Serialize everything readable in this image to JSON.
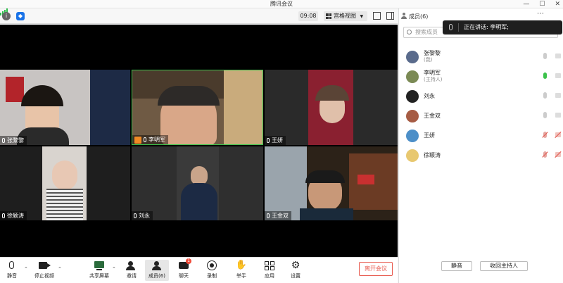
{
  "window": {
    "title": "腾讯会议",
    "minimize": "—",
    "maximize": "☐",
    "close": "✕"
  },
  "toolbar": {
    "time": "09:08",
    "view_label": "宫格视图"
  },
  "tiles": [
    {
      "name": "张黎黎",
      "bg": "#c8c4c2",
      "host": false
    },
    {
      "name": "李明军",
      "bg": "#6f5a44",
      "host": true
    },
    {
      "name": "王妍",
      "bg": "#8a2030",
      "host": false
    },
    {
      "name": "徐颖涛",
      "bg": "#d9d4cf",
      "host": false
    },
    {
      "name": "刘永",
      "bg": "#3a3a3a",
      "host": false
    },
    {
      "name": "王金双",
      "bg": "#2c2218",
      "host": false
    }
  ],
  "bottombar": {
    "mute": "静音",
    "stop_video": "停止视频",
    "share": "共享屏幕",
    "invite": "邀请",
    "members": "成员(6)",
    "chat": "聊天",
    "chat_badge": "1",
    "record": "录制",
    "raise_hand": "举手",
    "apps": "应用",
    "settings": "设置",
    "leave": "离开会议"
  },
  "panel": {
    "title": "成员(6)",
    "search_placeholder": "搜索成员",
    "speaking": "正在讲话: 李明军;",
    "members": [
      {
        "name": "张黎黎",
        "role": "(我)",
        "mic": "idle",
        "cam": "idle",
        "avatar_color": "#5a6b8c"
      },
      {
        "name": "李明军",
        "role": "(主持人)",
        "mic": "on",
        "cam": "idle",
        "avatar_color": "#7b8a55"
      },
      {
        "name": "刘永",
        "role": "",
        "mic": "idle",
        "cam": "idle",
        "avatar_color": "#222222"
      },
      {
        "name": "王金双",
        "role": "",
        "mic": "idle",
        "cam": "idle",
        "avatar_color": "#a65c44"
      },
      {
        "name": "王妍",
        "role": "",
        "mic": "off",
        "cam": "off",
        "avatar_color": "#4d8fc8"
      },
      {
        "name": "徐颖涛",
        "role": "",
        "mic": "off",
        "cam": "off",
        "avatar_color": "#e8c870"
      }
    ],
    "mute_all": "静音",
    "reclaim_host": "收回主持人"
  }
}
